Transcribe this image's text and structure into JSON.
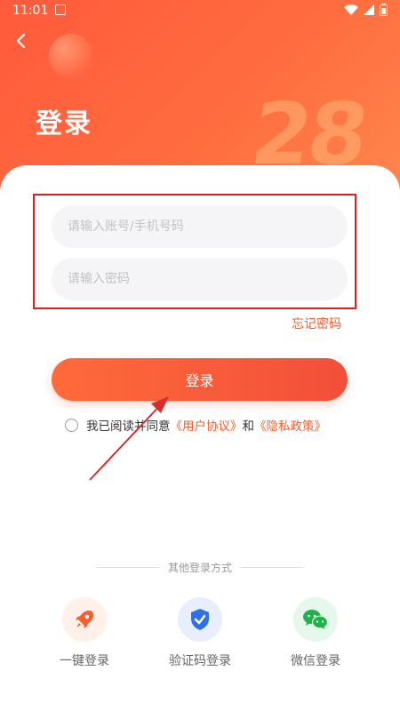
{
  "status_bar": {
    "time": "11:01"
  },
  "header": {
    "title": "登录",
    "decor_number": "28"
  },
  "form": {
    "account_placeholder": "请输入账号/手机号码",
    "password_placeholder": "请输入密码",
    "forgot_label": "忘记密码",
    "login_label": "登录"
  },
  "agreement": {
    "prefix": "我已阅读并同意",
    "user_agreement": "《用户协议》",
    "and": "和",
    "privacy_policy": "《隐私政策》"
  },
  "other_login": {
    "title": "其他登录方式",
    "options": [
      {
        "label": "一键登录",
        "icon": "rocket-icon"
      },
      {
        "label": "验证码登录",
        "icon": "shield-check-icon"
      },
      {
        "label": "微信登录",
        "icon": "wechat-icon"
      }
    ]
  },
  "colors": {
    "accent": "#f4602f",
    "highlight_box": "#e11d1d",
    "annotation_arrow": "#d32f2f"
  }
}
